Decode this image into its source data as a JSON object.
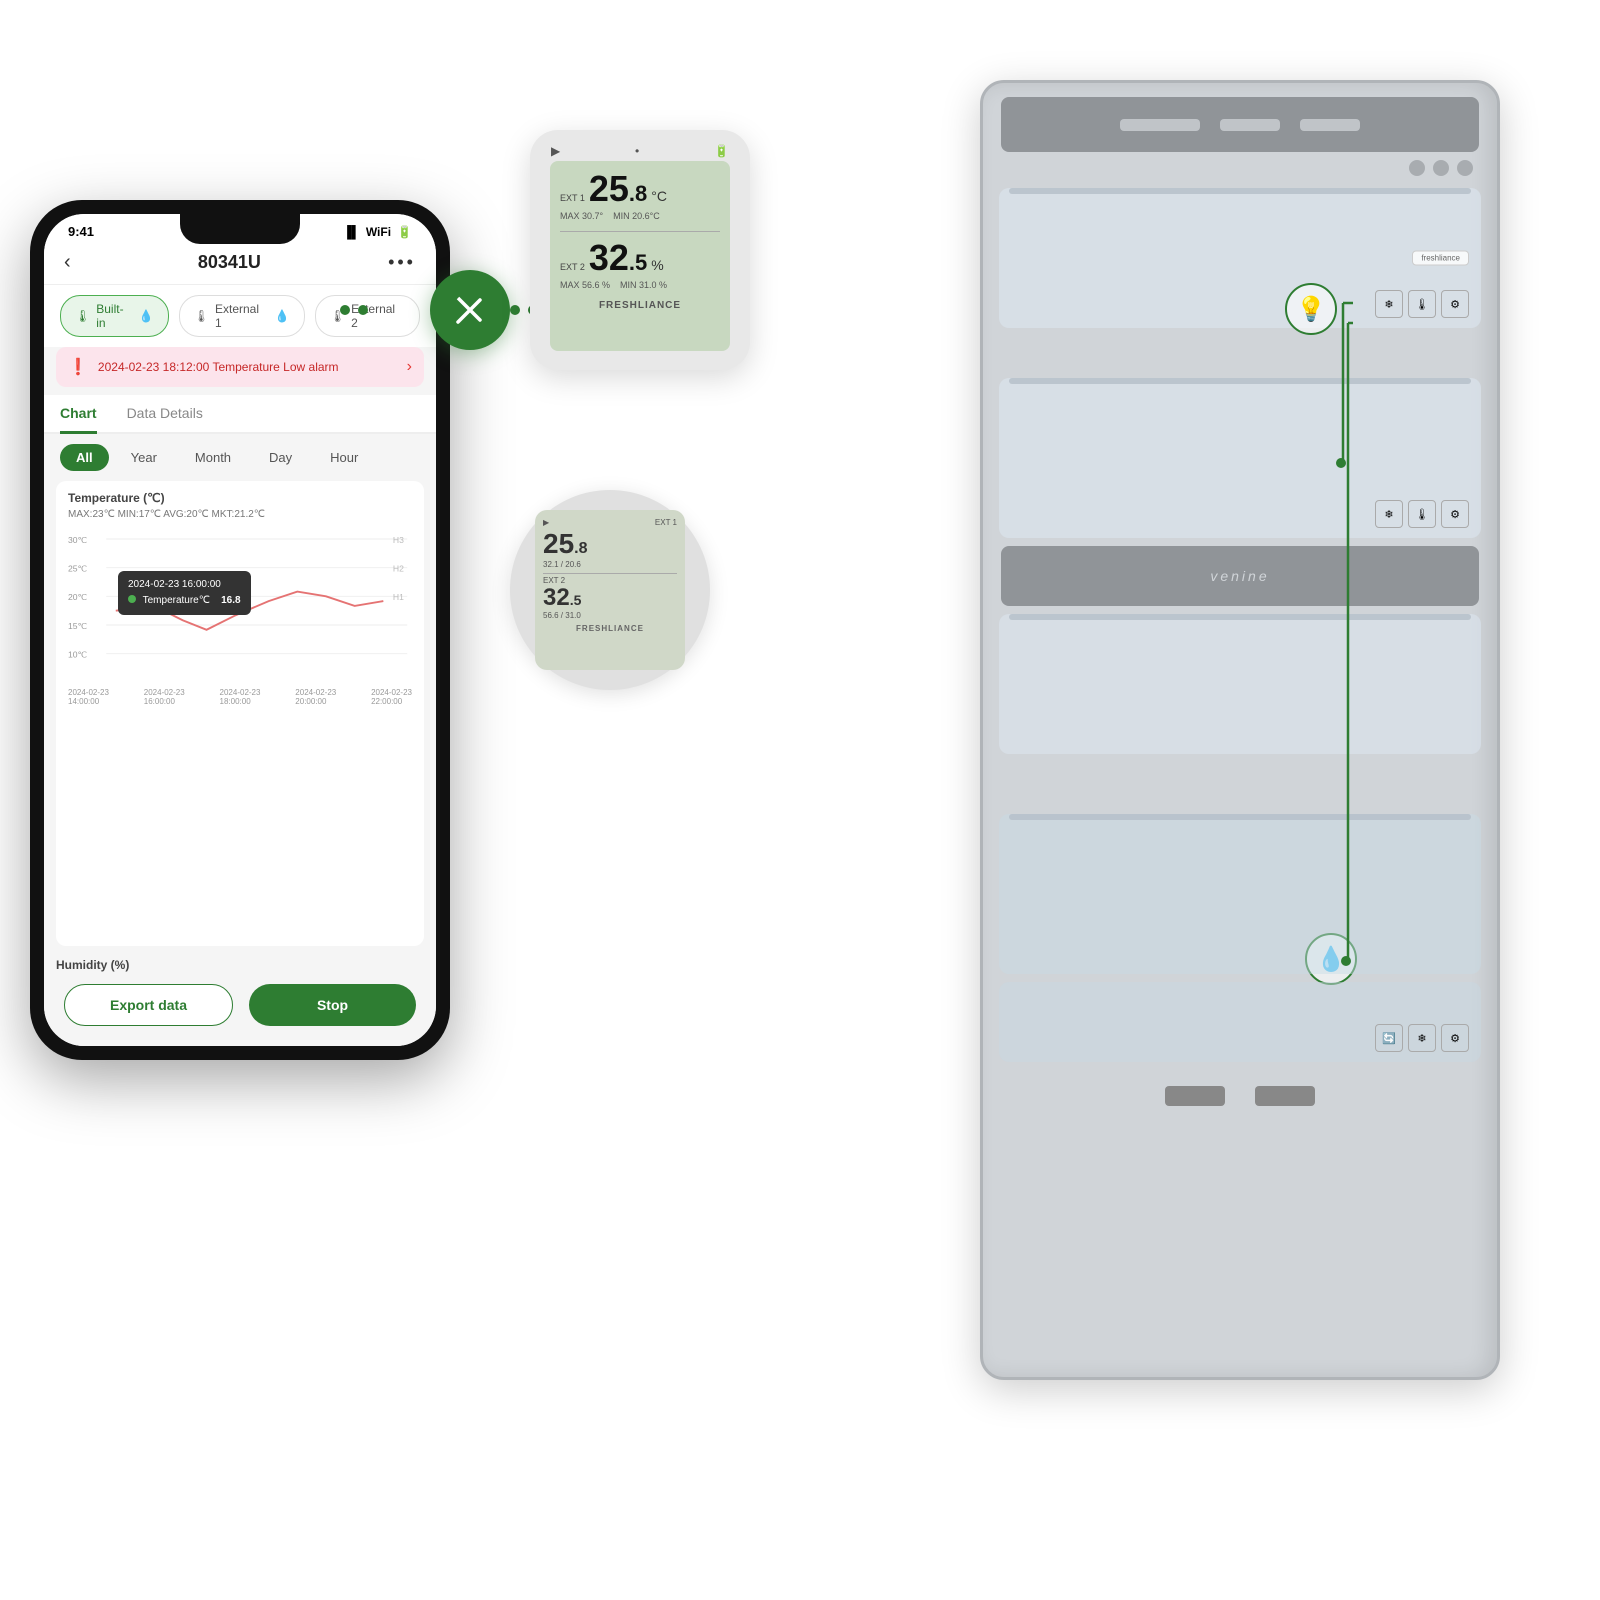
{
  "app": {
    "status_time": "9:41",
    "back_btn": "‹",
    "title": "80341U",
    "more_btn": "•••"
  },
  "sensor_tabs": [
    {
      "label": "Built-in",
      "icon": "🌡",
      "active": true
    },
    {
      "label": "External 1",
      "icon": "🌡",
      "active": false
    },
    {
      "label": "External 2",
      "icon": "🌡",
      "active": false
    }
  ],
  "alarm": {
    "text": "2024-02-23 18:12:00 Temperature Low alarm"
  },
  "chart_tabs": [
    {
      "label": "Chart",
      "active": true
    },
    {
      "label": "Data Details",
      "active": false
    }
  ],
  "time_range": [
    {
      "label": "All",
      "active": true
    },
    {
      "label": "Year",
      "active": false
    },
    {
      "label": "Month",
      "active": false
    },
    {
      "label": "Day",
      "active": false
    },
    {
      "label": "Hour",
      "active": false
    }
  ],
  "temperature_chart": {
    "section_label": "Temperature (℃)",
    "stats": "MAX:23℃  MIN:17℃  AVG:20℃  MKT:21.2℃",
    "y_labels": [
      "30℃",
      "25℃",
      "20℃",
      "15℃",
      "10℃"
    ],
    "h_labels": [
      "H3",
      "H2",
      "H1"
    ],
    "x_labels": [
      "2024-02-23\n14:00:00",
      "2024-02-23\n16:00:00",
      "2024-02-23\n18:00:00",
      "2024-02-23\n20:00:00",
      "2024-02-23\n22:00:00"
    ],
    "tooltip": {
      "time": "2024-02-23 16:00:00",
      "label": "Temperature℃",
      "value": "16.8"
    }
  },
  "humidity_label": "Humidity (%)",
  "buttons": {
    "export": "Export data",
    "stop": "Stop"
  },
  "device1": {
    "ext1_label": "EXT 1",
    "temp1": "25.8",
    "unit1": "°C",
    "max1": "30.7",
    "min1": "20.6",
    "ext2_label": "EXT 2",
    "temp2": "32.5",
    "unit2": "%",
    "max2": "56.6",
    "min2": "31.0",
    "brand": "FRESHLIANCE"
  },
  "fridge": {
    "brand": "venine",
    "label": "freshliance"
  },
  "colors": {
    "green_dark": "#2e7d32",
    "green_light": "#e8f5e9",
    "alarm_bg": "#fce4ec",
    "alarm_text": "#c62828"
  }
}
